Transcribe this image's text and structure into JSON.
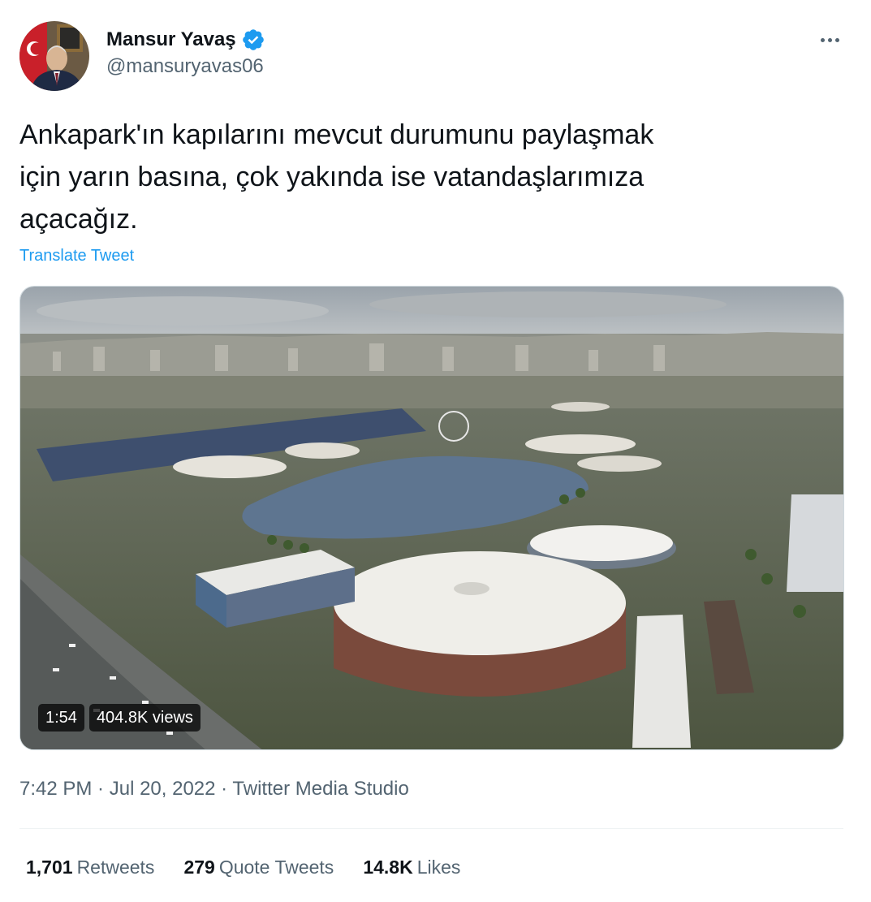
{
  "author": {
    "display_name": "Mansur Yavaş",
    "handle": "@mansuryavas06",
    "verified_icon": "verified-badge-icon"
  },
  "more_icon": "more-options-icon",
  "tweet": {
    "text": "Ankapark'ın kapılarını mevcut durumunu paylaşmak\niçin yarın basına, çok yakında ise vatandaşlarımıza\naçacağız.",
    "translate_label": "Translate Tweet"
  },
  "video": {
    "duration": "1:54",
    "views": "404.8K views"
  },
  "meta": {
    "time": "7:42 PM",
    "separator1": " · ",
    "date": "Jul 20, 2022",
    "separator2": " · ",
    "source": "Twitter Media Studio"
  },
  "stats": {
    "retweets_count": "1,701",
    "retweets_label": "Retweets",
    "quotes_count": "279",
    "quotes_label": "Quote Tweets",
    "likes_count": "14.8K",
    "likes_label": "Likes"
  },
  "colors": {
    "accent": "#1d9bf0",
    "text": "#0f1419",
    "secondary": "#536471"
  }
}
